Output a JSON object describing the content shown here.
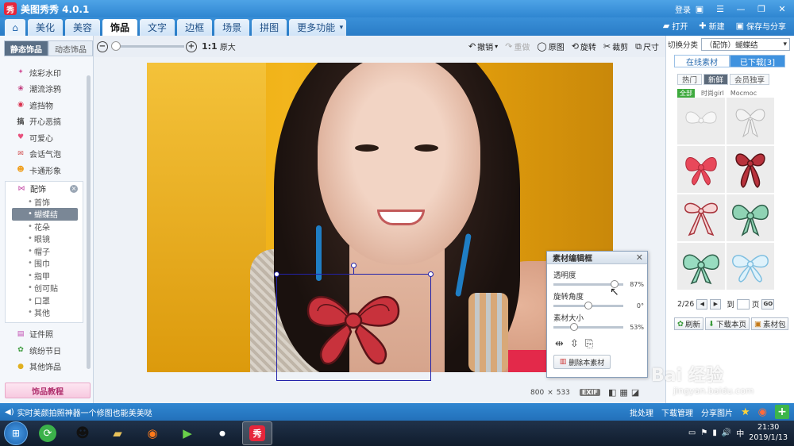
{
  "app": {
    "title": "美图秀秀 4.0.1",
    "logo_text": "秀",
    "login": "登录"
  },
  "nav": {
    "tabs": [
      "美化",
      "美容",
      "饰品",
      "文字",
      "边框",
      "场景",
      "拼图",
      "更多功能"
    ],
    "active": "饰品",
    "right": {
      "open": "打开",
      "new": "新建",
      "save": "保存与分享"
    }
  },
  "sidebar": {
    "tabs": [
      "静态饰品",
      "动态饰品"
    ],
    "items": [
      "炫彩水印",
      "潮流涂鸦",
      "遮挡物",
      "开心恶搞",
      "可爱心",
      "会话气泡",
      "卡通形象"
    ],
    "group": {
      "label": "配饰",
      "children": [
        "首饰",
        "蝴蝶结",
        "花朵",
        "眼镜",
        "帽子",
        "围巾",
        "指甲",
        "创可贴",
        "口罩",
        "其他"
      ],
      "active": "蝴蝶结"
    },
    "items_after": [
      "证件照",
      "缤纷节日",
      "其他饰品"
    ],
    "tutorial": "饰品教程"
  },
  "toolbar": {
    "zoom_ratio": "1:1",
    "zoom_orig": "原大",
    "undo": "撤销",
    "redo": "重做",
    "original": "原图",
    "rotate": "旋转",
    "crop": "裁剪",
    "size": "尺寸"
  },
  "image": {
    "width": "800",
    "height": "533",
    "x_sign": "×",
    "exif": "EXIF"
  },
  "panel": {
    "title": "素材编辑框",
    "opacity_label": "透明度",
    "opacity": "87%",
    "rotate_label": "旋转角度",
    "rotate": "0°",
    "size_label": "素材大小",
    "size": "53%",
    "delete": "删除本素材",
    "opacity_pos": 0.87,
    "rotate_pos": 0.5,
    "size_pos": 0.3
  },
  "rpanel": {
    "switch_label": "切换分类",
    "category": "（配饰）蝴蝶结",
    "tabs": [
      "在线素材",
      "已下载[3]"
    ],
    "filters": [
      "热门",
      "新鲜",
      "会员独享"
    ],
    "subfilters": [
      "全部",
      "时尚girl",
      "Mocmoc"
    ],
    "page": "2/26",
    "goto": "到",
    "page_unit": "页",
    "go": "GO",
    "actions": [
      "刷新",
      "下载本页",
      "素材包"
    ]
  },
  "statusbar": {
    "message": "实时美颜拍照神器一个修图也能美美哒",
    "batch": "批处理",
    "download": "下载管理",
    "share": "分享图片"
  },
  "taskbar": {
    "time": "21:30",
    "date": "2019/1/13"
  },
  "watermark": {
    "text": "Bai 经验",
    "url": "jingyan.baidu.com"
  },
  "colors": {
    "accent": "#2f86d1",
    "bow_red": "#c8323c",
    "bow_mint": "#8fd3b4"
  }
}
